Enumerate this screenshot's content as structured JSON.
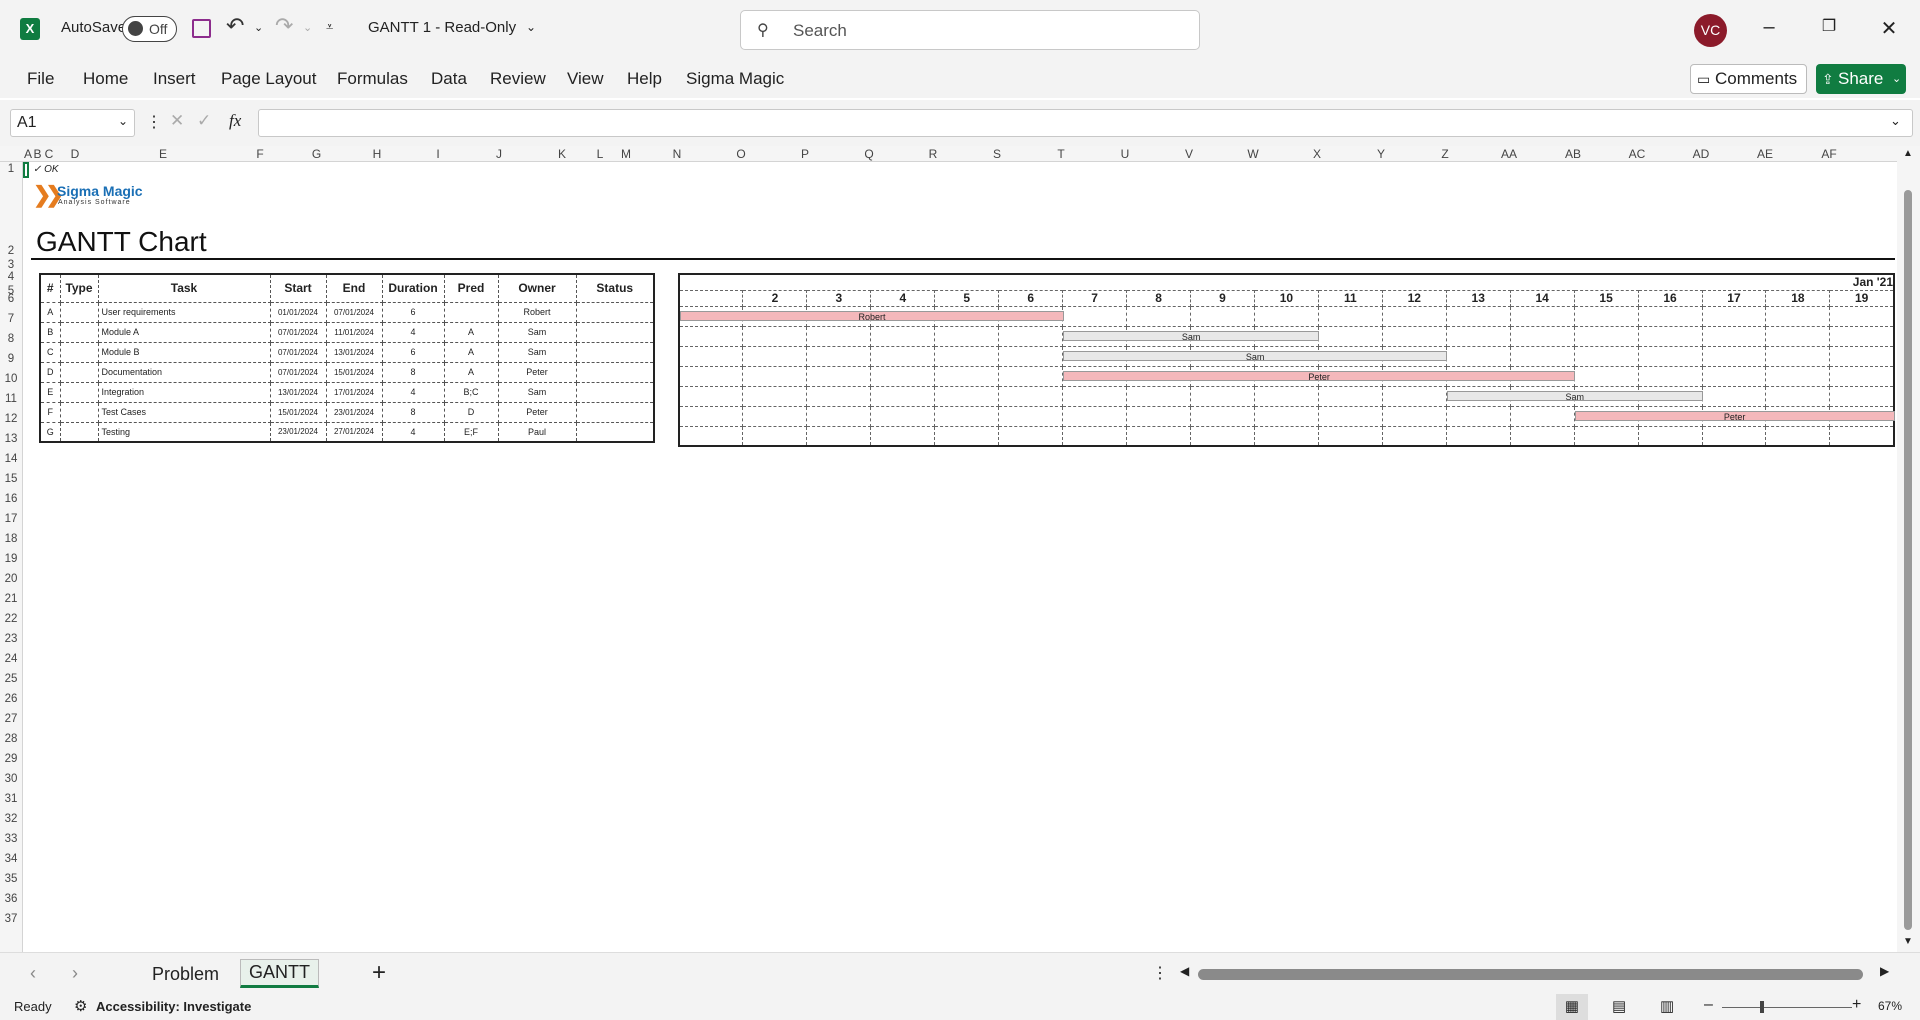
{
  "app": {
    "title": "GANTT 1  -  Read-Only",
    "autosave_label": "AutoSave",
    "autosave_state": "Off",
    "search_placeholder": "Search",
    "avatar_initials": "VC",
    "brand_color": "#107c41"
  },
  "menu": [
    "File",
    "Home",
    "Insert",
    "Page Layout",
    "Formulas",
    "Data",
    "Review",
    "View",
    "Help",
    "Sigma Magic"
  ],
  "buttons": {
    "comments": "Comments",
    "share": "Share"
  },
  "formula_bar": {
    "name_box": "A1",
    "fx": "fx",
    "value": ""
  },
  "columns": [
    "A",
    "B",
    "C",
    "D",
    "E",
    "F",
    "G",
    "H",
    "I",
    "J",
    "K",
    "L",
    "M",
    "N",
    "O",
    "P",
    "Q",
    "R",
    "S",
    "T",
    "U",
    "V",
    "W",
    "X",
    "Y",
    "Z",
    "AA",
    "AB",
    "AC",
    "AD",
    "AE",
    "AF"
  ],
  "rows": [
    "1",
    "2",
    "3",
    "4",
    "5",
    "6",
    "7",
    "8",
    "9",
    "10",
    "11",
    "12",
    "13",
    "14",
    "15",
    "16",
    "17",
    "18",
    "19",
    "20",
    "21",
    "22",
    "23",
    "24",
    "25",
    "26",
    "27",
    "28",
    "29",
    "30",
    "31",
    "32",
    "33",
    "34",
    "35",
    "36",
    "37"
  ],
  "sheet": {
    "ok_text": "✓ OK",
    "logo_main": "Sigma Magic",
    "logo_sub": "Analysis Software",
    "title": "GANTT Chart",
    "table_headers": [
      "#",
      "Type",
      "Task",
      "Start",
      "End",
      "Duration",
      "Pred",
      "Owner",
      "Status"
    ],
    "tasks": [
      {
        "id": "A",
        "type": "",
        "task": "User requirements",
        "start": "01/01/2024",
        "end": "07/01/2024",
        "duration": "6",
        "pred": "",
        "owner": "Robert",
        "status": ""
      },
      {
        "id": "B",
        "type": "",
        "task": "Module A",
        "start": "07/01/2024",
        "end": "11/01/2024",
        "duration": "4",
        "pred": "A",
        "owner": "Sam",
        "status": ""
      },
      {
        "id": "C",
        "type": "",
        "task": "Module B",
        "start": "07/01/2024",
        "end": "13/01/2024",
        "duration": "6",
        "pred": "A",
        "owner": "Sam",
        "status": ""
      },
      {
        "id": "D",
        "type": "",
        "task": "Documentation",
        "start": "07/01/2024",
        "end": "15/01/2024",
        "duration": "8",
        "pred": "A",
        "owner": "Peter",
        "status": ""
      },
      {
        "id": "E",
        "type": "",
        "task": "Integration",
        "start": "13/01/2024",
        "end": "17/01/2024",
        "duration": "4",
        "pred": "B;C",
        "owner": "Sam",
        "status": ""
      },
      {
        "id": "F",
        "type": "",
        "task": "Test Cases",
        "start": "15/01/2024",
        "end": "23/01/2024",
        "duration": "8",
        "pred": "D",
        "owner": "Peter",
        "status": ""
      },
      {
        "id": "G",
        "type": "",
        "task": "Testing",
        "start": "23/01/2024",
        "end": "27/01/2024",
        "duration": "4",
        "pred": "E;F",
        "owner": "Paul",
        "status": ""
      }
    ],
    "gantt_month": "Jan '21",
    "gantt_days": [
      "",
      "2",
      "3",
      "4",
      "5",
      "6",
      "7",
      "8",
      "9",
      "10",
      "11",
      "12",
      "13",
      "14",
      "15",
      "16",
      "17",
      "18",
      "19"
    ],
    "gantt_bars": [
      {
        "row": 0,
        "start": 1,
        "end": 7,
        "label": "Robert",
        "color": "#f4b8bb"
      },
      {
        "row": 1,
        "start": 7,
        "end": 11,
        "label": "Sam",
        "color": "#e8e8e8"
      },
      {
        "row": 2,
        "start": 7,
        "end": 13,
        "label": "Sam",
        "color": "#e8e8e8"
      },
      {
        "row": 3,
        "start": 7,
        "end": 15,
        "label": "Peter",
        "color": "#f4b8bb"
      },
      {
        "row": 4,
        "start": 13,
        "end": 17,
        "label": "Sam",
        "color": "#e8e8e8"
      },
      {
        "row": 5,
        "start": 15,
        "end": 20,
        "label": "Peter",
        "color": "#f4b8bb"
      }
    ]
  },
  "tabs": [
    "Problem",
    "GANTT"
  ],
  "active_tab": "GANTT",
  "status": {
    "ready": "Ready",
    "accessibility": "Accessibility: Investigate",
    "zoom": "67%"
  }
}
